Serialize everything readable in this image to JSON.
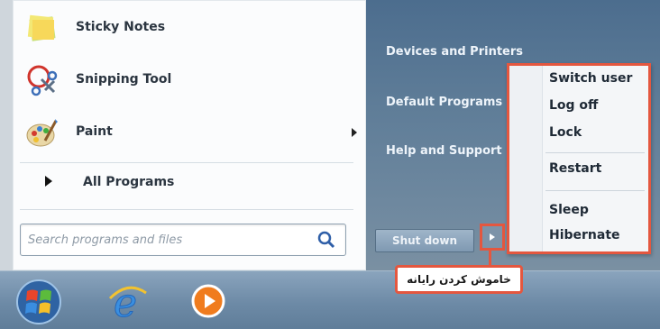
{
  "start_menu": {
    "programs": [
      {
        "label": "Sticky Notes",
        "icon": "sticky-notes-icon",
        "has_submenu": false
      },
      {
        "label": "Snipping Tool",
        "icon": "snipping-tool-icon",
        "has_submenu": false
      },
      {
        "label": "Paint",
        "icon": "paint-icon",
        "has_submenu": true
      }
    ],
    "all_programs_label": "All Programs",
    "search": {
      "placeholder": "Search programs and files",
      "value": ""
    },
    "right_links": [
      "Devices and Printers",
      "Default Programs",
      "Help and Support"
    ],
    "shutdown": {
      "label": "Shut down"
    },
    "power_menu": {
      "groups": [
        [
          "Switch user",
          "Log off",
          "Lock"
        ],
        [
          "Restart"
        ],
        [
          "Sleep",
          "Hibernate"
        ]
      ]
    }
  },
  "callout": {
    "text": "خاموش کردن رایانه"
  },
  "taskbar": {
    "items": [
      {
        "icon": "start-orb-icon"
      },
      {
        "icon": "internet-explorer-icon"
      },
      {
        "icon": "media-player-icon"
      }
    ]
  },
  "colors": {
    "highlight": "#e4573f",
    "panel_blue": "#5f7d98",
    "taskbar": "#6d8aa6"
  }
}
